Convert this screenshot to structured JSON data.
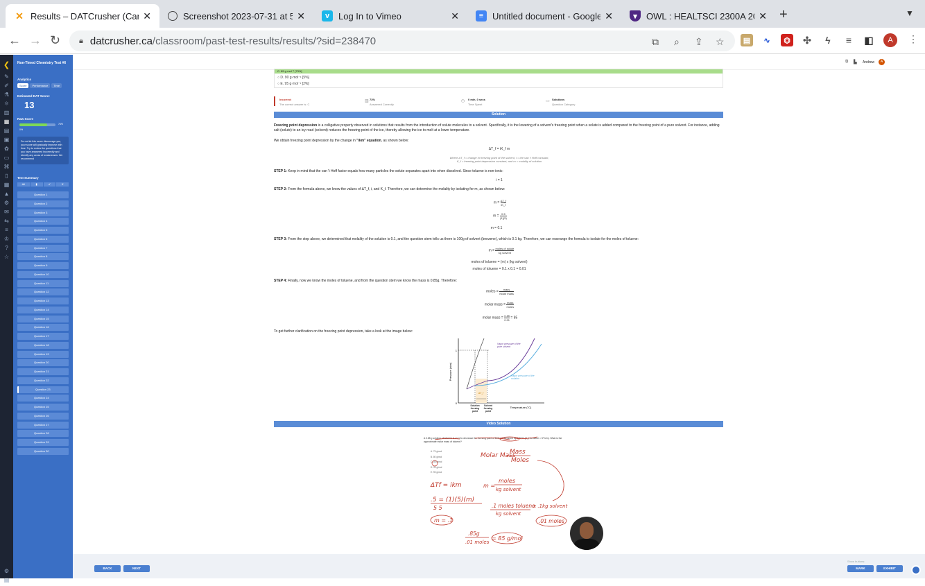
{
  "browser": {
    "tabs": [
      {
        "title": "Results – DATCrusher (Canadia",
        "icon": "datcrusher-x-icon",
        "active": true
      },
      {
        "title": "Screenshot 2023-07-31 at 5.0",
        "icon": "globe-icon",
        "active": false
      },
      {
        "title": "Log In to Vimeo",
        "icon": "vimeo-icon",
        "active": false
      },
      {
        "title": "Untitled document - Google Do",
        "icon": "google-docs-icon",
        "active": false
      },
      {
        "title": "OWL : HEALTSCI 2300A 200 S",
        "icon": "owl-shield-icon",
        "active": false
      }
    ],
    "url_host": "datcrusher.ca",
    "url_path": "/classroom/past-test-results/results/?sid=238470",
    "profile_initial": "A"
  },
  "sidebar": {
    "title": "Non-Timed Chemistry Test #6",
    "analytics_label": "Analytics",
    "analytics_tabs": [
      "Score",
      "Performance",
      "Time"
    ],
    "estimated_label": "Estimated DAT Score:",
    "estimated_score": "13",
    "raw_label": "Raw Score",
    "raw_percent": "76%",
    "raw_fraction": 0.76,
    "raw_zero": "0%",
    "note": "Do not let this score discourage you, your score will gradually improve with time. Try to review the questions that you have answered incorrectly and identify any areas of weaknesses. We recommend",
    "summary_label": "Test Summary",
    "filters": [
      "All",
      "▮",
      "✔",
      "✕"
    ],
    "questions": [
      "Question 1",
      "Question 2",
      "Question 3",
      "Question 4",
      "Question 5",
      "Question 6",
      "Question 7",
      "Question 8",
      "Question 9",
      "Question 10",
      "Question 11",
      "Question 12",
      "Question 13",
      "Question 14",
      "Question 15",
      "Question 16",
      "Question 17",
      "Question 18",
      "Question 19",
      "Question 20",
      "Question 21",
      "Question 22",
      "Question 23",
      "Question 24",
      "Question 25",
      "Question 26",
      "Question 27",
      "Question 28",
      "Question 29",
      "Question 30"
    ]
  },
  "header": {
    "user": "Andrew",
    "user_initial": "A"
  },
  "question": {
    "choice_c": "C. 85 g·mol⁻¹ [73%]",
    "choice_d": "D. 90 g·mol⁻¹ [5%]",
    "choice_e": "E. 95 g·mol⁻¹ [2%]"
  },
  "result": {
    "status": "Incorrect",
    "status_sub": "The correct answer is: C",
    "answered_pct": "73%",
    "answered_label": "Answered Correctly",
    "time": "0 min, 0 secs",
    "time_label": "Time Spent",
    "category": "Solutions",
    "category_label": "Question Category"
  },
  "solution": {
    "header": "Solution",
    "intro_bold": "Freezing point depression",
    "intro": " is a colligative property observed in solutions that results from the introduction of solute molecules to a solvent. Specifically, it is the lowering of a solvent's freezing point when a solute is added compared to the freezing point of a pure solvent. For instance, adding salt (solute) to an icy road (solvent) reduces the freezing point of the ice, thereby allowing the ice to melt at a lower temperature.",
    "obtain_pre": "We obtain freezing point depression by the change in ",
    "obtain_bold": "\"ikm\" equation",
    "obtain_post": ", as shown below:",
    "eq_main": "ΔT_f = iK_f m",
    "eq_where1": "Where ΔT_f = change in freezing point of the solvent, i = the van 't Hoff constant,",
    "eq_where2": "K_f = freezing point depression constant, and m = molality of solution",
    "step1_bold": "STEP 1:",
    "step1": " Keep in mind that the van 't Hoff factor equals how many particles the solute separates apart into when dissolved. Since toluene is non-ionic:",
    "step1_eq": "i = 1",
    "step2_bold": "STEP 2:",
    "step2": " From the formula above, we know the values of ΔT_f, i, and K_f. Therefore, we can determine the molality by isolating for m, as shown below:",
    "step2_eq1_lhs": "m =",
    "step2_eq1_num": "ΔT_f",
    "step2_eq1_den": "iK_f",
    "step2_eq2_num": "0.5",
    "step2_eq2_den": "(1)(5)",
    "step2_eq3": "m = 0.1",
    "step3_bold": "STEP 3:",
    "step3": " From the step above, we determined that molality of the solution is 0.1, and the question stem tells us there is 100g of solvent (benzene), which is 0.1 kg. Therefore, we can rearrange the formula to isolate for the moles of toluene:",
    "step3_eq1_num": "moles of solute",
    "step3_eq1_den": "kg solvent",
    "step3_eq2": "moles of toluene = (m) x (kg solvent)",
    "step3_eq3": "moles of toluene = 0.1 x 0.1 = 0.01",
    "step4_bold": "STEP 4:",
    "step4": " Finally, now we know the moles of toluene, and from the question stem we know the mass is 0.85g. Therefore:",
    "step4_eq1_lhs": "moles =",
    "step4_eq1_num": "mass",
    "step4_eq1_den": "molar mass",
    "step4_eq2_lhs": "molar mass =",
    "step4_eq2_num": "mass",
    "step4_eq2_den": "moles",
    "step4_eq3_lhs": "molar mass =",
    "step4_eq3_num": "0.85",
    "step4_eq3_den": "0.01",
    "step4_eq3_rhs": "= 85",
    "clarify": "To get further clarification on the freezing point depression, take a look at the image below:",
    "graph": {
      "ylabel": "Pressure (atm)",
      "xlabel": "Temperature (°C)",
      "y_one": "1",
      "y_zero": "0",
      "label_pure": "Vapor pressure of the pure solvent",
      "label_solution": "Vapor pressure of the solution",
      "x_solution": "Solution freezing point",
      "x_solvent": "Solvent freezing point",
      "delta": "ΔT_f"
    },
    "video_header": "Video Solution",
    "video_question": "A 0.85 g solution of toluene is used to decrease the freezing point of 100 g of benzene by 0.50°C (K_f benzene = 5°C/m). What is the approximate molar mass of toluene?",
    "video_choices": [
      "A. 75 g/mol",
      "B. 80 g/mol",
      "C. 85 g/mol",
      "D. 90 g/mol",
      "E. 95 g/mol"
    ],
    "handwriting": {
      "molar_mass": "Molar Mass",
      "mass": "Mass",
      "moles": "Moles",
      "dtf": "ΔTf = ikm",
      "calc": ".5 = (1)(5)(m)",
      "calc_den": "5     5",
      "m_result": "m = .1",
      "m_eq_num": "moles",
      "m_eq_den": "kg solvent",
      "m_eq_lhs": "m =",
      "conv_num": ".1 moles toluene",
      "conv_den": "kg solvent",
      "conv_x": "x .1kg solvent",
      "result_moles": ".01 moles",
      "frac_num": ".85g",
      "frac_den": ".01 moles",
      "answer": "= 85 g/mol"
    }
  },
  "footer": {
    "back": "BACK",
    "next": "NEXT",
    "hint": "Show buttons:",
    "mark": "MARK",
    "exhibit": "EXHIBIT"
  }
}
